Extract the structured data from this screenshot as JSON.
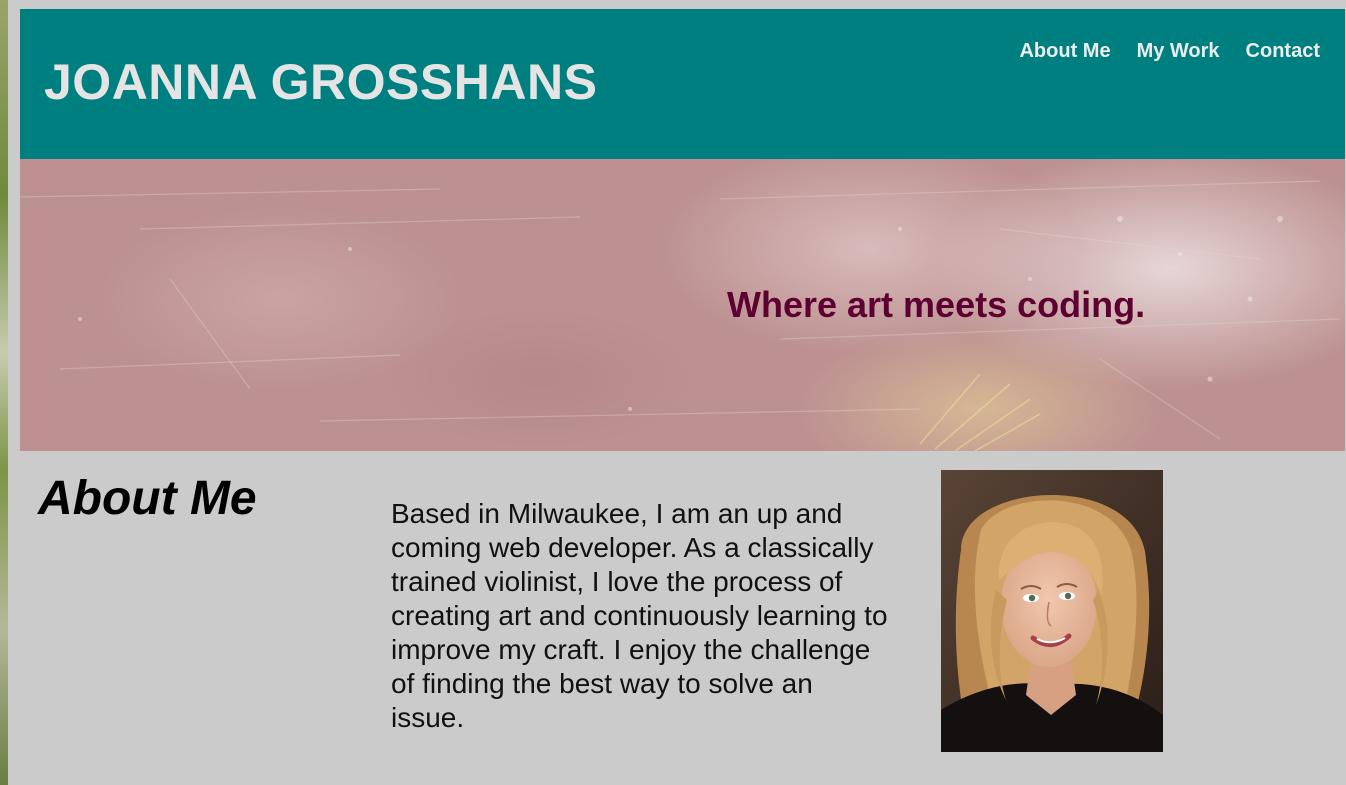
{
  "site": {
    "title": "JOANNA GROSSHANS"
  },
  "nav": {
    "items": [
      {
        "label": "About Me"
      },
      {
        "label": "My Work"
      },
      {
        "label": "Contact"
      }
    ]
  },
  "hero": {
    "tagline": "Where art meets coding."
  },
  "about": {
    "heading": "About Me",
    "text": "Based in Milwaukee, I am an up and coming web developer. As a classically trained violinist, I love the process of creating art and continuously learning to improve my craft. I enjoy the challenge of finding the best way to solve an issue."
  },
  "colors": {
    "header_bg": "#007f80",
    "hero_bg": "#bd9191",
    "tagline": "#5e0032",
    "page_bg": "#cbcbcb"
  }
}
